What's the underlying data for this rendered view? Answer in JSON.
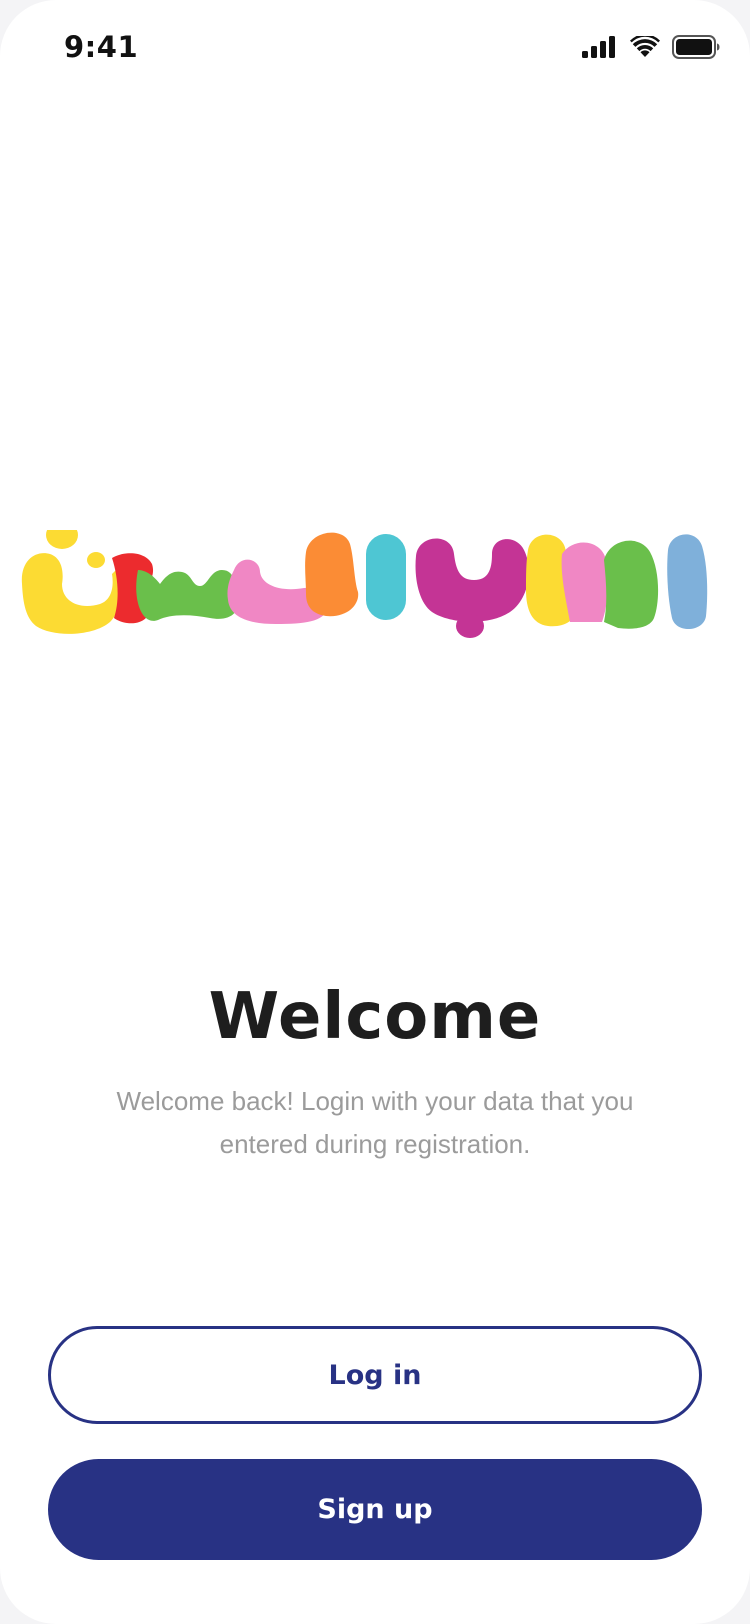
{
  "status_bar": {
    "time": "9:41",
    "icons": [
      "cellular-signal-icon",
      "wifi-icon",
      "battery-icon"
    ]
  },
  "logo": {
    "alt_text": "العاب الحسين",
    "colors": [
      "#fcdb33",
      "#ec2b2e",
      "#6abf4b",
      "#f087c4",
      "#fb8c35",
      "#4ec6d3",
      "#c43495",
      "#6abf4b",
      "#7fb0da"
    ]
  },
  "welcome": {
    "title": "Welcome",
    "subtitle": "Welcome back! Login with your data that you entered during registration."
  },
  "buttons": {
    "login_label": "Log in",
    "signup_label": "Sign up"
  },
  "colors": {
    "primary": "#283284",
    "title_text": "#1e1e1e",
    "subtitle_text": "#9b9b9b",
    "background": "#ffffff"
  }
}
